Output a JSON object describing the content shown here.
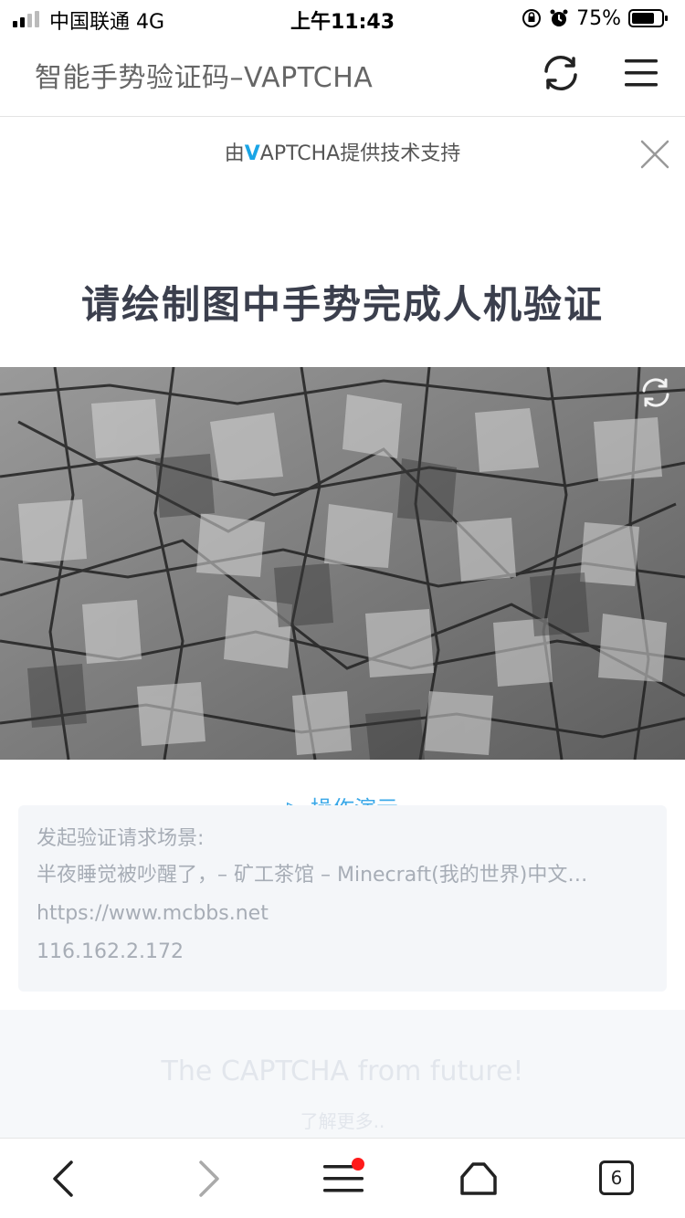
{
  "status_bar": {
    "carrier": "中国联通  4G",
    "time": "上午11:43",
    "battery": "75%"
  },
  "browser": {
    "page_title": "智能手势验证码–VAPTCHA",
    "tabs_count": "6",
    "icons": {
      "refresh": "refresh-icon",
      "menu": "menu-icon",
      "back": "back-arrow-icon",
      "forward": "forward-arrow-icon",
      "more": "more-menu-icon",
      "home": "home-icon"
    },
    "notification_color": "#ff1a1a"
  },
  "captcha": {
    "powered_prefix": "由",
    "powered_brand_v": "V",
    "powered_brand_rest": "APTCHA",
    "powered_suffix": "提供技术支持",
    "headline": "请绘制图中手势完成人机验证",
    "demo_link": "▷ 操作演示",
    "accent_color": "#1aa5e6"
  },
  "info": {
    "label": "发起验证请求场景:",
    "scene_title": "半夜睡觉被吵醒了，– 矿工茶馆 – Minecraft(我的世界)中文…",
    "url": "https://www.mcbbs.net",
    "ip": "116.162.2.172"
  },
  "footer": {
    "tagline": "The CAPTCHA from future!",
    "learn_more": "了解更多.."
  }
}
